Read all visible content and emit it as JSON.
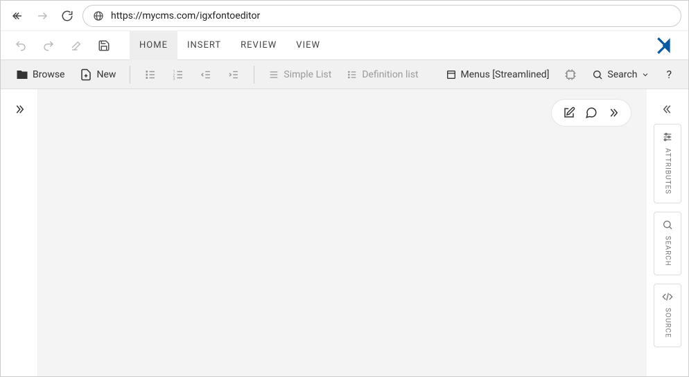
{
  "browser": {
    "url": "https://mycms.com/igxfontoeditor"
  },
  "tabs": {
    "home": "HOME",
    "insert": "INSERT",
    "review": "REVIEW",
    "view": "VIEW"
  },
  "ribbon": {
    "browse": "Browse",
    "newdoc": "New",
    "simple_list": "Simple List",
    "definition_list": "Definition list",
    "menus_label": "Menus [Streamlined]",
    "search": "Search",
    "help": "?"
  },
  "side": {
    "attributes": "ATTRIBUTES",
    "search": "SEARCH",
    "source": "SOURCE"
  }
}
